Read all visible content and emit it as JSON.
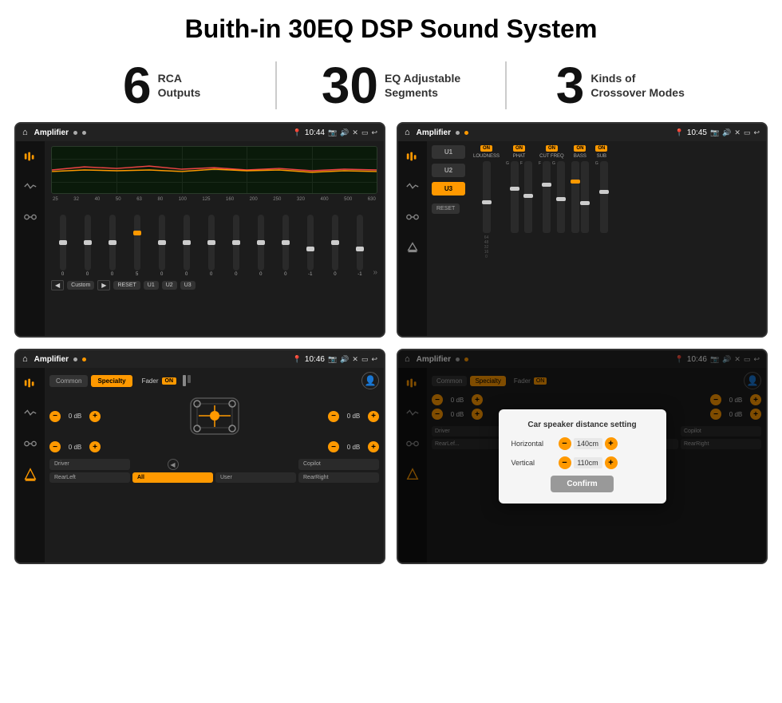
{
  "header": {
    "title": "Buith-in 30EQ DSP Sound System"
  },
  "stats": [
    {
      "number": "6",
      "label_line1": "RCA",
      "label_line2": "Outputs"
    },
    {
      "number": "30",
      "label_line1": "EQ Adjustable",
      "label_line2": "Segments"
    },
    {
      "number": "3",
      "label_line1": "Kinds of",
      "label_line2": "Crossover Modes"
    }
  ],
  "screens": {
    "eq": {
      "title": "Amplifier",
      "time": "10:44",
      "freq_labels": [
        "25",
        "32",
        "40",
        "50",
        "63",
        "80",
        "100",
        "125",
        "160",
        "200",
        "250",
        "320",
        "400",
        "500",
        "630"
      ],
      "slider_values": [
        "0",
        "0",
        "0",
        "5",
        "0",
        "0",
        "0",
        "0",
        "0",
        "0",
        "-1",
        "0",
        "-1"
      ],
      "preset": "Custom",
      "buttons": [
        "RESET",
        "U1",
        "U2",
        "U3"
      ]
    },
    "crossover": {
      "title": "Amplifier",
      "time": "10:45",
      "u_buttons": [
        "U1",
        "U2",
        "U3"
      ],
      "fader_groups": [
        {
          "label": "LOUDNESS",
          "on": true
        },
        {
          "label": "PHAT",
          "on": true
        },
        {
          "label": "CUT FREQ",
          "on": true
        },
        {
          "label": "BASS",
          "on": true
        },
        {
          "label": "SUB",
          "on": true
        }
      ],
      "reset_label": "RESET"
    },
    "fader": {
      "title": "Amplifier",
      "time": "10:46",
      "tabs": [
        "Common",
        "Specialty"
      ],
      "active_tab": "Specialty",
      "fader_label": "Fader",
      "fader_on": "ON",
      "vol_rows": [
        {
          "left_val": "0 dB",
          "right_val": "0 dB"
        },
        {
          "left_val": "0 dB",
          "right_val": "0 dB"
        }
      ],
      "bottom_buttons": [
        "Driver",
        "",
        "Copilot",
        "RearLeft",
        "All",
        "",
        "User",
        "RearRight"
      ]
    },
    "dialog": {
      "title": "Amplifier",
      "time": "10:46",
      "tabs": [
        "Common",
        "Specialty"
      ],
      "dialog_title": "Car speaker distance setting",
      "horizontal_label": "Horizontal",
      "horizontal_value": "140cm",
      "vertical_label": "Vertical",
      "vertical_value": "110cm",
      "confirm_label": "Confirm",
      "bottom_left": "RearLef...",
      "bottom_right": "RearRight",
      "right_vals": [
        "0 dB",
        "0 dB"
      ]
    }
  }
}
